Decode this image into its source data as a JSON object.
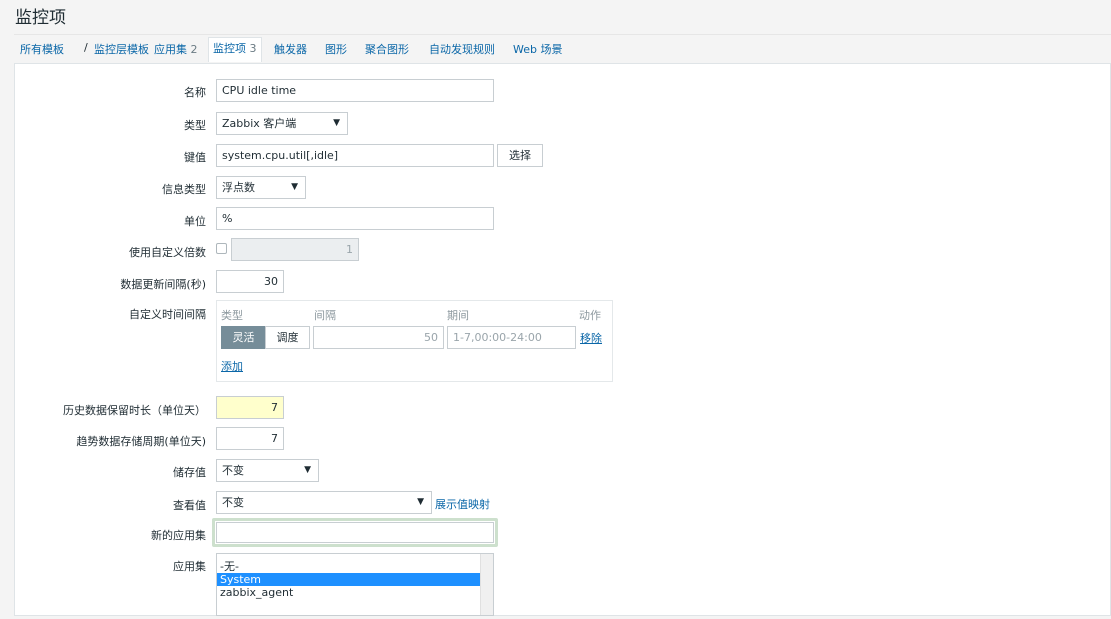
{
  "page": {
    "title": "监控项"
  },
  "breadcrumb": {
    "all_templates": "所有模板",
    "separator": "/",
    "template_name": "监控层模板",
    "applications_label": "应用集",
    "applications_count": "2",
    "items_label": "监控项",
    "items_count": "3",
    "triggers": "触发器",
    "graphs": "图形",
    "screens": "聚合图形",
    "discovery": "自动发现规则",
    "web": "Web 场景"
  },
  "form": {
    "name": {
      "label": "名称",
      "value": "CPU idle time"
    },
    "type": {
      "label": "类型",
      "value": "Zabbix 客户端"
    },
    "key": {
      "label": "键值",
      "value": "system.cpu.util[,idle]",
      "select_button": "选择"
    },
    "info_type": {
      "label": "信息类型",
      "value": "浮点数"
    },
    "units": {
      "label": "单位",
      "value": "%"
    },
    "multiplier": {
      "label": "使用自定义倍数",
      "checked": false,
      "value": "1"
    },
    "update_interval": {
      "label": "数据更新间隔(秒)",
      "value": "30"
    },
    "custom_intervals": {
      "label": "自定义时间间隔",
      "headers": {
        "type": "类型",
        "interval": "间隔",
        "period": "期间",
        "action": "动作"
      },
      "row": {
        "flexible": "灵活",
        "scheduling": "调度",
        "interval": "50",
        "period": "1-7,00:00-24:00",
        "remove": "移除"
      },
      "add": "添加"
    },
    "history": {
      "label": "历史数据保留时长（单位天）",
      "value": "7"
    },
    "trends": {
      "label": "趋势数据存储周期(单位天)",
      "value": "7"
    },
    "store_value": {
      "label": "储存值",
      "value": "不变"
    },
    "show_value": {
      "label": "查看值",
      "value": "不变",
      "mapping_link": "展示值映射"
    },
    "new_application": {
      "label": "新的应用集",
      "value": ""
    },
    "applications": {
      "label": "应用集",
      "options": [
        "-无-",
        "System",
        "zabbix_agent"
      ],
      "selected": "System"
    }
  }
}
